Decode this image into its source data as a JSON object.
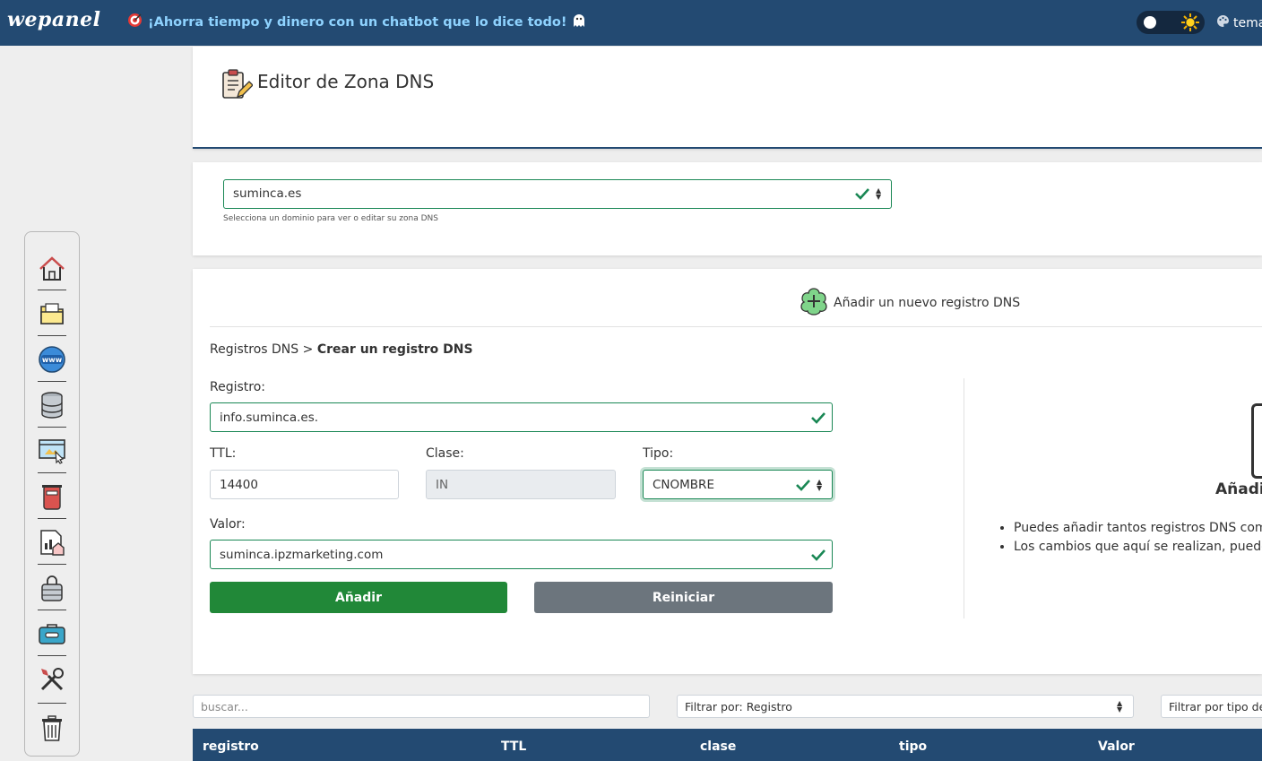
{
  "header": {
    "logo": "wepanel",
    "promo": "¡Ahorra tiempo y dinero con un chatbot que lo dice todo!",
    "theme_label": "temas"
  },
  "sidebar": {
    "items": [
      "home-icon",
      "folder-icon",
      "globe-www-icon",
      "database-icon",
      "website-builder-icon",
      "mailbox-icon",
      "stats-icon",
      "ssl-lock-icon",
      "toolbox-icon",
      "tools-icon",
      "trash-icon"
    ]
  },
  "page": {
    "title": "Editor de Zona DNS"
  },
  "domain": {
    "selected": "suminca.es",
    "help": "Selecciona un dominio para ver o editar su zona DNS"
  },
  "form": {
    "add_header": "Añadir un nuevo registro DNS",
    "breadcrumb_parent": "Registros DNS",
    "breadcrumb_sep": ">",
    "breadcrumb_current": "Crear un registro DNS",
    "registro_label": "Registro:",
    "registro_value": "info.suminca.es.",
    "ttl_label": "TTL:",
    "ttl_value": "14400",
    "clase_label": "Clase:",
    "clase_value": "IN",
    "tipo_label": "Tipo:",
    "tipo_value": "CNOMBRE",
    "valor_label": "Valor:",
    "valor_value": "suminca.ipzmarketing.com",
    "add_button": "Añadir",
    "reset_button": "Reiniciar"
  },
  "info": {
    "title": "Añadir",
    "bullets": [
      "Puedes añadir tantos registros DNS como",
      "Los cambios que aquí se realizan, pueden"
    ]
  },
  "filters": {
    "search_placeholder": "buscar...",
    "filter_registro": "Filtrar por: Registro",
    "filter_tipo": "Filtrar por tipo de"
  },
  "table": {
    "columns": [
      "registro",
      "TTL",
      "clase",
      "tipo",
      "Valor"
    ]
  },
  "colors": {
    "header_bg": "#234a72",
    "valid_green": "#198754",
    "button_green": "#218838",
    "button_gray": "#6c757d",
    "promo_text": "#8fd3ff"
  }
}
